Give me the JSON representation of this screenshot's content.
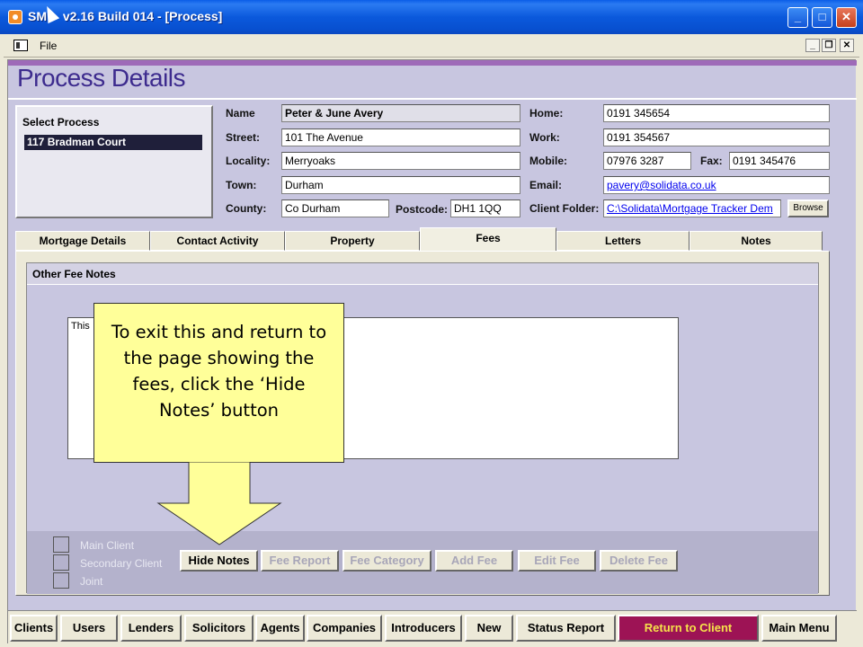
{
  "window": {
    "title": "SMT v2.16 Build 014 - [Process]",
    "title_visible": "SM",
    "title_rest": " v2.16 Build 014 - [Process]",
    "buttons": [
      "_",
      "□",
      "✕"
    ]
  },
  "menu": {
    "file_label": "File",
    "mdi_buttons": [
      "_",
      "❐",
      "✕"
    ]
  },
  "page": {
    "title": "Process Details"
  },
  "select_process": {
    "label": "Select Process",
    "items": [
      "117 Bradman Court"
    ]
  },
  "client": {
    "name_label": "Name",
    "name": "Peter & June Avery",
    "street_label": "Street:",
    "street": "101 The Avenue",
    "locality_label": "Locality:",
    "locality": "Merryoaks",
    "town_label": "Town:",
    "town": "Durham",
    "county_label": "County:",
    "county": "Co Durham",
    "postcode_label": "Postcode:",
    "postcode": "DH1 1QQ",
    "home_label": "Home:",
    "home": "0191 345654",
    "work_label": "Work:",
    "work": "0191 354567",
    "mobile_label": "Mobile:",
    "mobile": "07976 3287",
    "fax_label": "Fax:",
    "fax": "0191 345476",
    "email_label": "Email:",
    "email": "pavery@solidata.co.uk",
    "folder_label": "Client Folder:",
    "folder": "C:\\Solidata\\Mortgage Tracker Dem",
    "browse_label": "Browse"
  },
  "tabs": [
    {
      "label": "Mortgage Details",
      "active": false
    },
    {
      "label": "Contact Activity",
      "active": false
    },
    {
      "label": "Property",
      "active": false
    },
    {
      "label": "Fees",
      "active": true
    },
    {
      "label": "Letters",
      "active": false
    },
    {
      "label": "Notes",
      "active": false
    }
  ],
  "fees_panel": {
    "header": "Other Fee Notes",
    "notes_text": "This",
    "checkbox_labels": [
      "Main Client",
      "Secondary Client",
      "Joint"
    ],
    "buttons": [
      {
        "label": "Hide Notes",
        "enabled": true
      },
      {
        "label": "Fee Report",
        "enabled": false
      },
      {
        "label": "Fee Category",
        "enabled": false
      },
      {
        "label": "Add Fee",
        "enabled": false
      },
      {
        "label": "Edit Fee",
        "enabled": false
      },
      {
        "label": "Delete Fee",
        "enabled": false
      }
    ]
  },
  "nav": [
    {
      "label": "Clients"
    },
    {
      "label": "Users"
    },
    {
      "label": "Lenders"
    },
    {
      "label": "Solicitors"
    },
    {
      "label": "Agents"
    },
    {
      "label": "Companies"
    },
    {
      "label": "Introducers"
    },
    {
      "label": "New"
    },
    {
      "label": "Status Report"
    },
    {
      "label": "Return to Client"
    },
    {
      "label": "Main Menu"
    }
  ],
  "callout": {
    "text": "To exit this and return to the page showing the fees, click the ‘Hide Notes’ button"
  },
  "colors": {
    "title_bar": "#0A5DE8",
    "page_title": "#3D2B8E",
    "background": "#C8C6E0",
    "callout": "#FFFF99",
    "return_button_bg": "#9D1355",
    "return_button_text": "#F6E24A"
  }
}
